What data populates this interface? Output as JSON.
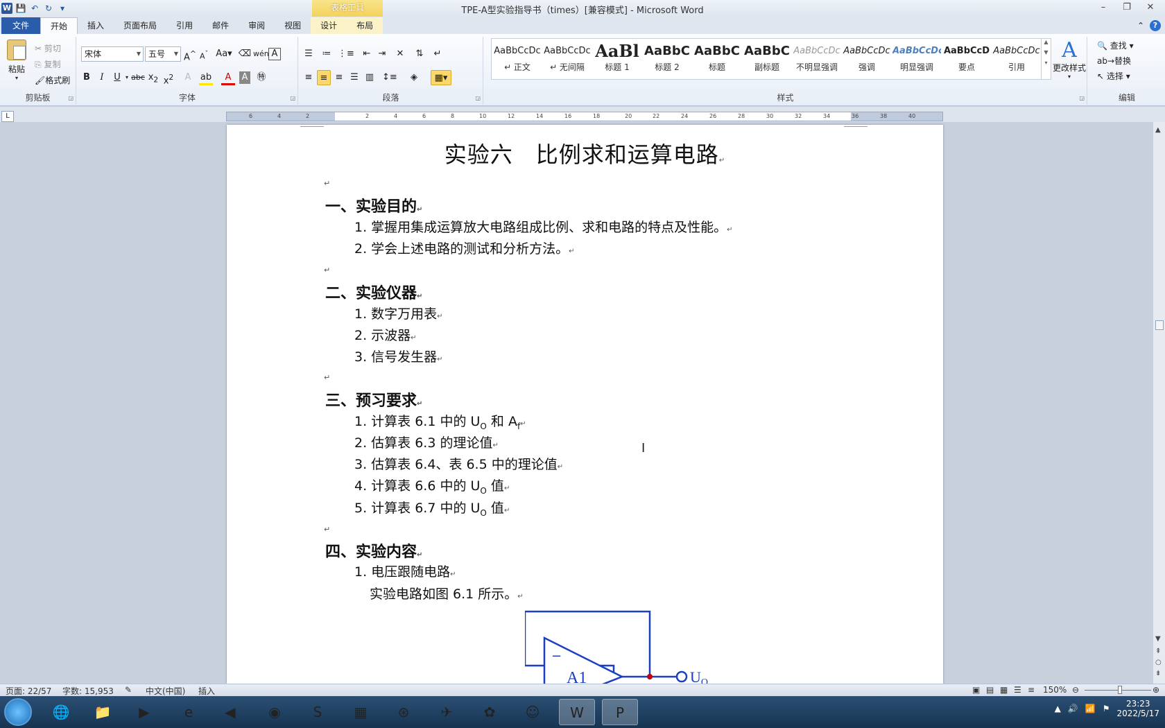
{
  "window": {
    "title": "TPE-A型实验指导书（times）[兼容模式] - Microsoft Word",
    "context_tab": "表格工具",
    "logo": "W"
  },
  "tabs": [
    "文件",
    "开始",
    "插入",
    "页面布局",
    "引用",
    "邮件",
    "审阅",
    "视图",
    "设计",
    "布局"
  ],
  "ribbon": {
    "clipboard": {
      "paste": "粘贴",
      "cut": "剪切",
      "copy": "复制",
      "format_painter": "格式刷",
      "label": "剪贴板"
    },
    "font": {
      "name": "宋体",
      "size": "五号",
      "label": "字体",
      "change_case": "Aa"
    },
    "paragraph": {
      "label": "段落"
    },
    "styles": {
      "label": "样式",
      "items": [
        {
          "preview": "AaBbCcDc",
          "name": "↵ 正文"
        },
        {
          "preview": "AaBbCcDc",
          "name": "↵ 无间隔"
        },
        {
          "preview": "AaBl",
          "name": "标题 1"
        },
        {
          "preview": "AaBbC",
          "name": "标题 2"
        },
        {
          "preview": "AaBbC",
          "name": "标题"
        },
        {
          "preview": "AaBbC",
          "name": "副标题"
        },
        {
          "preview": "AaBbCcDc",
          "name": "不明显强调"
        },
        {
          "preview": "AaBbCcDc",
          "name": "强调"
        },
        {
          "preview": "AaBbCcDc",
          "name": "明显强调"
        },
        {
          "preview": "AaBbCcD",
          "name": "要点"
        },
        {
          "preview": "AaBbCcDc",
          "name": "引用"
        }
      ],
      "change_styles": "更改样式"
    },
    "editing": {
      "find": "查找",
      "replace": "替换",
      "select": "选择",
      "label": "编辑"
    }
  },
  "ruler": {
    "ticks": [
      "6",
      "4",
      "2",
      "2",
      "4",
      "6",
      "8",
      "10",
      "12",
      "14",
      "16",
      "18",
      "20",
      "22",
      "24",
      "26",
      "28",
      "30",
      "32",
      "34",
      "36",
      "38",
      "40"
    ]
  },
  "document": {
    "title": "实验六　比例求和运算电路",
    "sections": [
      {
        "heading": "一、实验目的",
        "items": [
          "1. 掌握用集成运算放大电路组成比例、求和电路的特点及性能。",
          "2. 学会上述电路的测试和分析方法。"
        ]
      },
      {
        "heading": "二、实验仪器",
        "items": [
          "1. 数字万用表",
          "2. 示波器",
          "3. 信号发生器"
        ]
      },
      {
        "heading": "三、预习要求",
        "items": [
          "1. 计算表 6.1 中的 U",
          "2. 估算表 6.3 的理论值",
          "3. 估算表 6.4、表 6.5 中的理论值",
          "4. 计算表 6.6 中的 U",
          "5. 计算表 6.7 中的 U"
        ]
      },
      {
        "heading": "四、实验内容",
        "items": [
          "1. 电压跟随电路",
          "实验电路如图 6.1 所示。"
        ]
      }
    ],
    "item1_tail_a": "和 A",
    "item1_sub_o": "O",
    "item1_sub_f": "f",
    "value_word": "值",
    "circuit": {
      "opamp_label": "A1",
      "minus": "−",
      "output_label": "U",
      "output_sub": "O"
    }
  },
  "status": {
    "page": "页面: 22/57",
    "words": "字数: 15,953",
    "lang": "中文(中国)",
    "mode": "插入",
    "zoom": "150%"
  },
  "tray": {
    "time": "23:23",
    "date": "2022/5/17"
  }
}
